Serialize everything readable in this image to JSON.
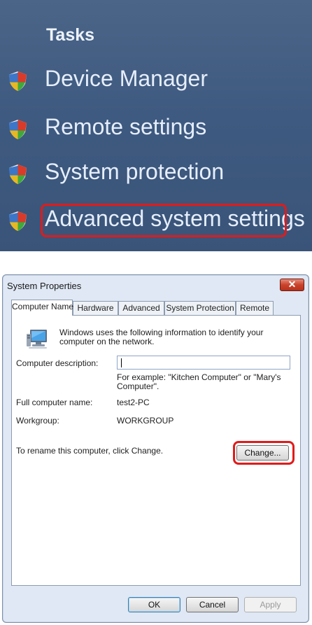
{
  "tasks_panel": {
    "title": "Tasks",
    "items": [
      {
        "label": "Device Manager"
      },
      {
        "label": "Remote settings"
      },
      {
        "label": "System protection"
      },
      {
        "label": "Advanced system settings"
      }
    ],
    "highlight_color": "#e01b1b"
  },
  "dialog": {
    "title": "System Properties",
    "close_glyph": "✕",
    "tabs": [
      {
        "label": "Computer Name",
        "active": true
      },
      {
        "label": "Hardware",
        "active": false
      },
      {
        "label": "Advanced",
        "active": false
      },
      {
        "label": "System Protection",
        "active": false
      },
      {
        "label": "Remote",
        "active": false
      }
    ],
    "computer_name": {
      "intro": "Windows uses the following information to identify your computer on the network.",
      "description_label": "Computer description:",
      "description_value": "",
      "example": "For example: \"Kitchen Computer\" or \"Mary's Computer\".",
      "full_name_label": "Full computer name:",
      "full_name_value": "test2-PC",
      "workgroup_label": "Workgroup:",
      "workgroup_value": "WORKGROUP",
      "rename_text": "To rename this computer, click Change.",
      "change_button": "Change..."
    },
    "buttons": {
      "ok": "OK",
      "cancel": "Cancel",
      "apply": "Apply"
    }
  }
}
